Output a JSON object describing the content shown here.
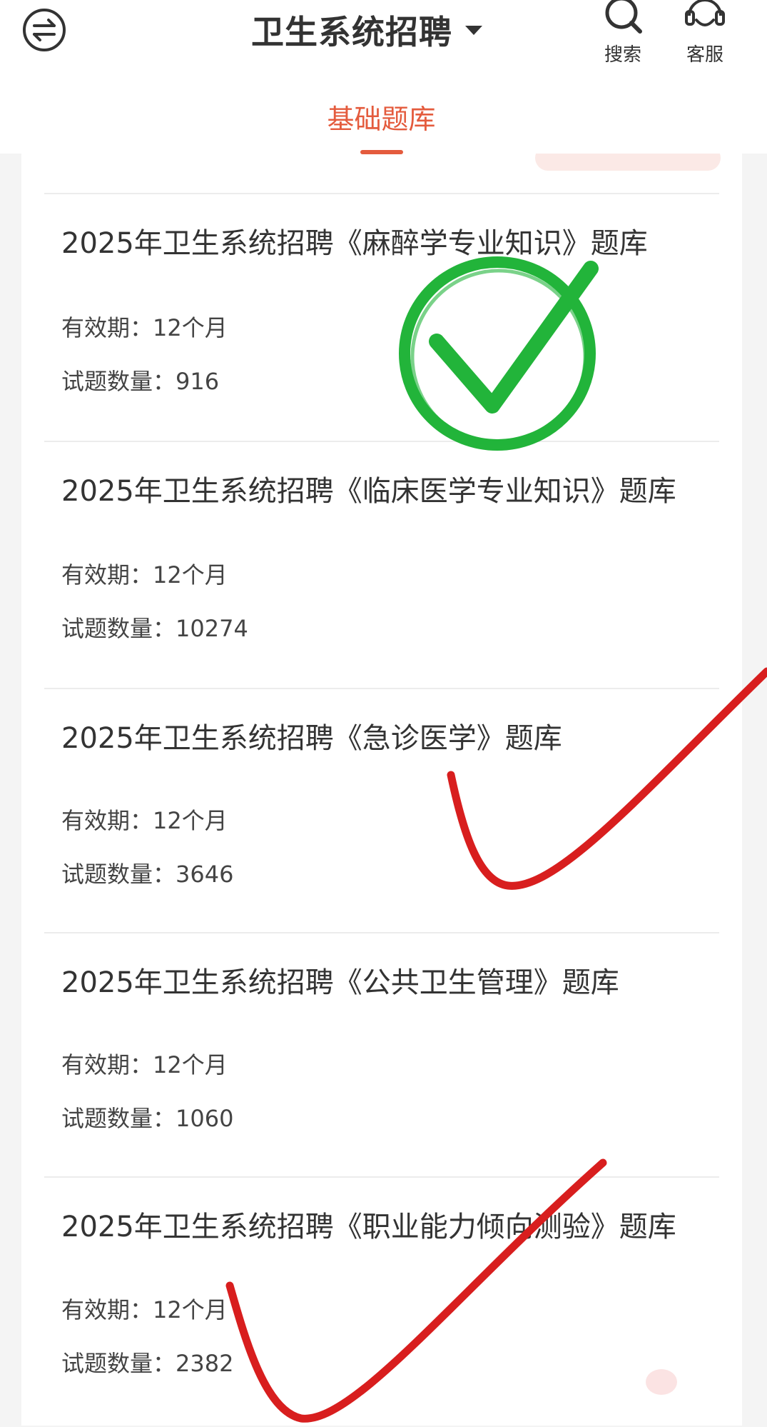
{
  "header": {
    "title": "卫生系统招聘",
    "search_label": "搜索",
    "service_label": "客服"
  },
  "tabs": [
    {
      "label": "基础题库",
      "active": true
    }
  ],
  "items": [
    {
      "title": "2025年卫生系统招聘《麻醉学专业知识》题库",
      "validity_label": "有效期：",
      "validity": "12个月",
      "count_label": "试题数量：",
      "count": "916"
    },
    {
      "title": "2025年卫生系统招聘《临床医学专业知识》题库",
      "validity_label": "有效期：",
      "validity": "12个月",
      "count_label": "试题数量：",
      "count": "10274"
    },
    {
      "title": "2025年卫生系统招聘《急诊医学》题库",
      "validity_label": "有效期：",
      "validity": "12个月",
      "count_label": "试题数量：",
      "count": "3646"
    },
    {
      "title": "2025年卫生系统招聘《公共卫生管理》题库",
      "validity_label": "有效期：",
      "validity": "12个月",
      "count_label": "试题数量：",
      "count": "1060"
    },
    {
      "title": "2025年卫生系统招聘《职业能力倾向测验》题库",
      "validity_label": "有效期：",
      "validity": "12个月",
      "count_label": "试题数量：",
      "count": "2382"
    }
  ],
  "icons": {
    "switch": "switch-arrows-icon",
    "search": "search-icon",
    "service": "headset-icon",
    "green_check": "green-circle-check-mark",
    "red_check": "red-check-mark"
  },
  "colors": {
    "accent": "#e45b3d",
    "green_mark": "#22b43a",
    "red_mark": "#d81e1e"
  }
}
